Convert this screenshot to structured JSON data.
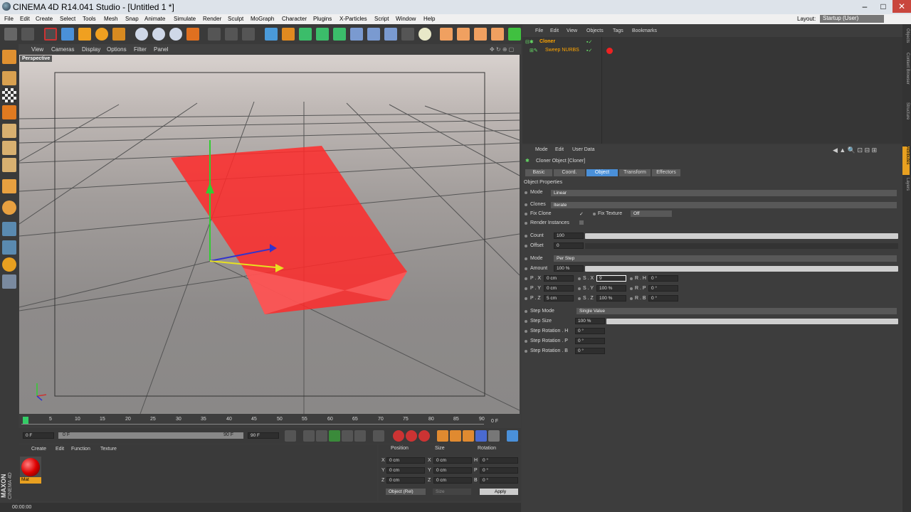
{
  "window": {
    "title": "CINEMA 4D R14.041 Studio - [Untitled 1 *]",
    "min": "–",
    "max": "□",
    "close": "✕"
  },
  "menu": [
    "File",
    "Edit",
    "Create",
    "Select",
    "Tools",
    "Mesh",
    "Snap",
    "Animate",
    "Simulate",
    "Render",
    "Sculpt",
    "MoGraph",
    "Character",
    "Plugins",
    "X-Particles",
    "Script",
    "Window",
    "Help"
  ],
  "layout": {
    "label": "Layout:",
    "value": "Startup (User)"
  },
  "viewport": {
    "menu": [
      "View",
      "Cameras",
      "Display",
      "Options",
      "Filter",
      "Panel"
    ],
    "name": "Perspective"
  },
  "timeline": {
    "ticks": [
      "0",
      "5",
      "10",
      "15",
      "20",
      "25",
      "30",
      "35",
      "40",
      "45",
      "50",
      "55",
      "60",
      "65",
      "70",
      "75",
      "80",
      "85",
      "90"
    ],
    "end_frame": "0 F"
  },
  "playbar": {
    "start": "0 F",
    "range_start": "0 F",
    "range_end": "90 F",
    "end": "90 F"
  },
  "materials": {
    "menu": [
      "Create",
      "Edit",
      "Function",
      "Texture"
    ],
    "items": [
      {
        "name": "Mat"
      }
    ]
  },
  "coords": {
    "headers": [
      "Position",
      "Size",
      "Rotation"
    ],
    "rows": [
      {
        "a": "X",
        "av": "0 cm",
        "b": "X",
        "bv": "0 cm",
        "c": "H",
        "cv": "0 °"
      },
      {
        "a": "Y",
        "av": "0 cm",
        "b": "Y",
        "bv": "0 cm",
        "c": "P",
        "cv": "0 °"
      },
      {
        "a": "Z",
        "av": "0 cm",
        "b": "Z",
        "bv": "0 cm",
        "c": "B",
        "cv": "0 °"
      }
    ],
    "mode": "Object (Rel)",
    "size": "Size",
    "apply": "Apply"
  },
  "status": {
    "time": "00:00:00"
  },
  "brand": {
    "line1": "MAXON",
    "line2": "CINEMA 4D"
  },
  "objects": {
    "menu": [
      "File",
      "Edit",
      "View",
      "Objects",
      "Tags",
      "Bookmarks"
    ],
    "items": [
      {
        "name": "Cloner"
      },
      {
        "name": "Sweep NURBS"
      }
    ]
  },
  "attributes": {
    "menu": [
      "Mode",
      "Edit",
      "User Data"
    ],
    "title": "Cloner Object [Cloner]",
    "tabs": [
      "Basic",
      "Coord.",
      "Object",
      "Transform",
      "Effectors"
    ],
    "section": "Object Properties",
    "mode_label": "Mode",
    "mode_value": "Linear",
    "clones_label": "Clones",
    "clones_value": "Iterate",
    "fix_clone": "Fix Clone",
    "fix_clone_check": "✓",
    "fix_texture": "Fix Texture",
    "fix_texture_value": "Off",
    "render_instances": "Render Instances",
    "count_label": "Count",
    "count_value": "100",
    "offset_label": "Offset",
    "offset_value": "0",
    "mode2_label": "Mode",
    "mode2_value": "Per Step",
    "amount_label": "Amount",
    "amount_value": "100 %",
    "px": "P . X",
    "px_v": "0 cm",
    "py": "P . Y",
    "py_v": "0 cm",
    "pz": "P . Z",
    "pz_v": "5 cm",
    "sx": "S . X",
    "sx_v": "9",
    "sy": "S . Y",
    "sy_v": "100 %",
    "sz": "S . Z",
    "sz_v": "100 %",
    "rh": "R . H",
    "rh_v": "0 °",
    "rp": "R . P",
    "rp_v": "0 °",
    "rb": "R . B",
    "rb_v": "0 °",
    "step_mode": "Step Mode",
    "step_mode_v": "Single Value",
    "step_size": "Step Size",
    "step_size_v": "100 %",
    "srh": "Step Rotation . H",
    "srh_v": "0 °",
    "srp": "Step Rotation . P",
    "srp_v": "0 °",
    "srb": "Step Rotation . B",
    "srb_v": "0 °"
  },
  "side_tabs": [
    "Attributes",
    "Layers"
  ],
  "side_tabs_top": [
    "Objects",
    "Content Browser",
    "Structure"
  ],
  "colors": {
    "accent": "#ffa500",
    "selected": "#4a90d9",
    "red": "#ff2a2a"
  }
}
